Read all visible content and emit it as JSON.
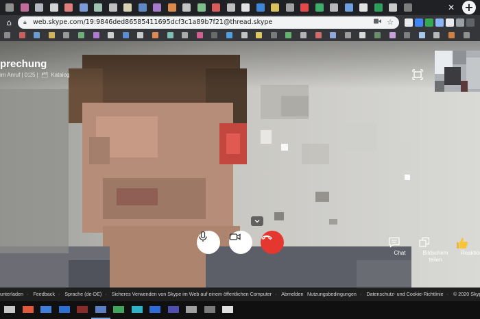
{
  "browser": {
    "tab_close_glyph": "✕",
    "new_tab_glyph": "+",
    "url": "web.skype.com/19:9846ded86585411695dcf3c1a89b7f21@thread.skype",
    "tab_favicon_colors": [
      "#8f8f8f",
      "#c06c9a",
      "#b5b8c1",
      "#d4d4d4",
      "#e07d7d",
      "#7a9ad8",
      "#9fc3b2",
      "#c0c0c0",
      "#d9d2b2",
      "#5f88c7",
      "#a47bc9",
      "#d98a4c",
      "#c2c2c2",
      "#7fbf8a",
      "#d75c5c",
      "#bfbfbf",
      "#e1e1e1",
      "#3f86d6",
      "#d8c15a",
      "#a1a1a1",
      "#e24a4a",
      "#3fae6a",
      "#b9b9b9",
      "#6ea0e0",
      "#e2e2e2",
      "#2f9d5b",
      "#c9c9c9",
      "#7c7c7c"
    ],
    "extension_colors": [
      "#e8eaed",
      "#4285f4",
      "#34a853",
      "#8ab4f8",
      "#e8eaed",
      "#9aa0a6",
      "#5f6368"
    ],
    "bookmark_colors": [
      "#8a8a8a",
      "#c96060",
      "#6c9bd2",
      "#d2b35a",
      "#9a9a9a",
      "#6fb07a",
      "#b07ad2",
      "#d0d0d0",
      "#5b8dd6",
      "#c9c9c9",
      "#e08855",
      "#7cc1b5",
      "#aaaaaa",
      "#d25f8f",
      "#6a6a6a",
      "#4f9ee0",
      "#c3c3c3",
      "#e0c860",
      "#7a7a7a",
      "#62b36b",
      "#b3b3b3",
      "#d26a6a",
      "#8fa8d8",
      "#9c9c9c",
      "#d9d9d9",
      "#6b8e6b",
      "#c8a0d8",
      "#7f7f7f",
      "#a8c8e8",
      "#b8b8b8",
      "#d08040",
      "#909090"
    ]
  },
  "call": {
    "title": "prechung",
    "status": "im Anruf | 0:25 |",
    "catalog": "Katalog",
    "actions": {
      "chat": "Chat",
      "share_line1": "Bildschirm",
      "share_line2": "teilen",
      "reactions": "Reaktion"
    },
    "accent_hangup": "#e3372f"
  },
  "footer": {
    "left": [
      "unterladen",
      "Feedback",
      "Sprache (de-DE)",
      "Sicheres Verwenden von Skype im Web auf einem öffentlichen Computer",
      "Abmelden"
    ],
    "right": [
      "Nutzungsbedingungen",
      "Datenschutz- und Cookie-Richtlinie",
      "© 2020 Skype"
    ]
  },
  "taskbar": {
    "item_colors": [
      "#c7c7c7",
      "#e05a3a",
      "#3f7fd9",
      "#2f6fd1",
      "#8a2b2b",
      "#5a7fc4",
      "#3fa55b",
      "#2db3c7",
      "#2f6bd6",
      "#4f4fb0",
      "#a0a0a0",
      "#7a7a7a",
      "#e0e0e0"
    ]
  }
}
